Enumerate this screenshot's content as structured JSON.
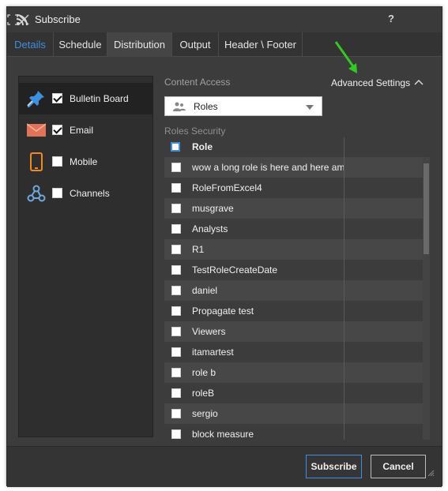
{
  "window": {
    "title": "Subscribe",
    "help_label": "?"
  },
  "tabs": [
    {
      "label": "Details"
    },
    {
      "label": "Schedule"
    },
    {
      "label": "Distribution"
    },
    {
      "label": "Output"
    },
    {
      "label": "Header \\ Footer"
    }
  ],
  "channels": [
    {
      "label": "Bulletin Board",
      "checked": true,
      "icon": "pushpin-icon"
    },
    {
      "label": "Email",
      "checked": true,
      "icon": "envelope-icon"
    },
    {
      "label": "Mobile",
      "checked": false,
      "icon": "mobile-phone-icon"
    },
    {
      "label": "Channels",
      "checked": false,
      "icon": "webhook-icon"
    }
  ],
  "content_access": {
    "label": "Content Access",
    "advanced_settings_label": "Advanced Settings",
    "dropdown_value": "Roles"
  },
  "roles_security": {
    "label": "Roles Security",
    "column_header": "Role",
    "rows": [
      "wow a long role is here and here am",
      "RoleFromExcel4",
      "musgrave",
      "Analysts",
      "R1",
      "TestRoleCreateDate",
      "daniel",
      "Propagate test",
      "Viewers",
      "itamartest",
      "role b",
      "roleB",
      "sergio",
      "block measure"
    ]
  },
  "footer": {
    "subscribe_label": "Subscribe",
    "cancel_label": "Cancel"
  },
  "colors": {
    "accent_blue": "#3d8fe0",
    "annotation_arrow": "#2ecc1f",
    "dialog_bg": "#3c3c3c",
    "selected_channel_bg": "#222222"
  }
}
